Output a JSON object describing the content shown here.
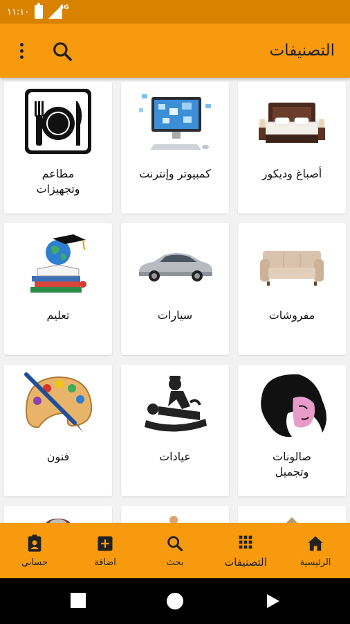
{
  "status_bar": {
    "time": "١١:١٠",
    "network": "4G"
  },
  "header": {
    "title": "التصنيفات"
  },
  "categories": [
    {
      "label": "أصباغ وديكور",
      "icon": "bed-icon"
    },
    {
      "label": "كمبيوتر وإنترنت",
      "icon": "computer-icon"
    },
    {
      "label": "مطاعم\nوتجهيزات",
      "icon": "restaurant-plate-icon"
    },
    {
      "label": "مفروشات",
      "icon": "sofa-icon"
    },
    {
      "label": "سيارات",
      "icon": "car-icon"
    },
    {
      "label": "تعليم",
      "icon": "education-globe-icon"
    },
    {
      "label": "صالونات\nوتجميل",
      "icon": "salon-woman-icon"
    },
    {
      "label": "عيادات",
      "icon": "clinic-patient-icon"
    },
    {
      "label": "فنون",
      "icon": "palette-icon"
    }
  ],
  "bottom_nav": {
    "home": "الرئيسية",
    "categories": "التصنيفات",
    "search": "بحث",
    "add": "اضافة",
    "account": "حسابي"
  },
  "colors": {
    "primary": "#f79a0e",
    "status_bar": "#d98200",
    "text": "#222222"
  }
}
